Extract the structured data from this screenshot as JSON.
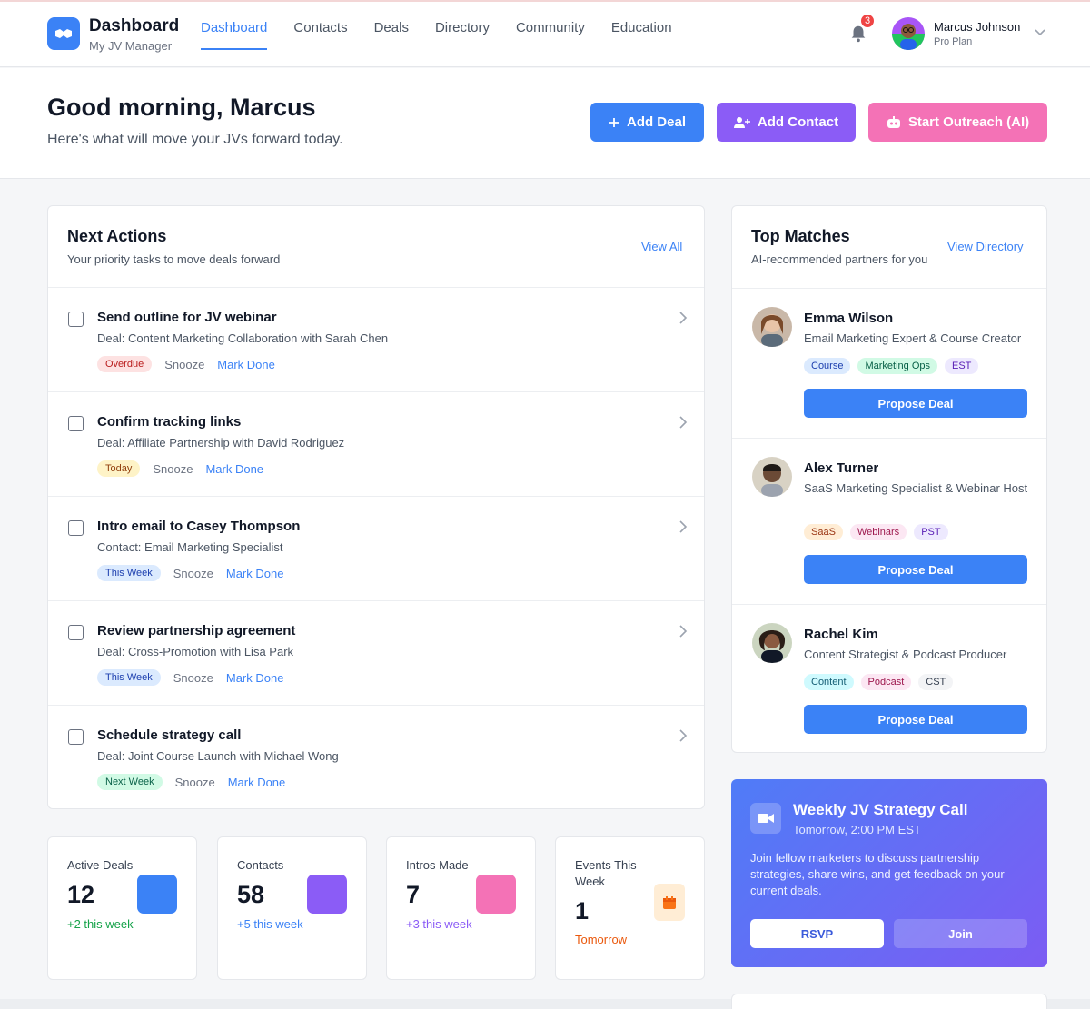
{
  "header": {
    "brand_title": "Dashboard",
    "brand_subtitle": "My JV Manager",
    "nav": [
      "Dashboard",
      "Contacts",
      "Deals",
      "Directory",
      "Community",
      "Education"
    ],
    "active_nav": "Dashboard",
    "notification_count": "3",
    "user_name": "Marcus Johnson",
    "user_plan": "Pro Plan"
  },
  "hero": {
    "greeting": "Good morning, Marcus",
    "subtitle": "Here's what will move your JVs forward today.",
    "add_deal": "Add Deal",
    "add_contact": "Add Contact",
    "start_outreach": "Start Outreach (AI)"
  },
  "next_actions": {
    "title": "Next Actions",
    "subtitle": "Your priority tasks to move deals forward",
    "view_all": "View All",
    "snooze_label": "Snooze",
    "mark_done_label": "Mark Done",
    "items": [
      {
        "title": "Send outline for JV webinar",
        "desc": "Deal: Content Marketing Collaboration with Sarah Chen",
        "tag": "Overdue"
      },
      {
        "title": "Confirm tracking links",
        "desc": "Deal: Affiliate Partnership with David Rodriguez",
        "tag": "Today"
      },
      {
        "title": "Intro email to Casey Thompson",
        "desc": "Contact: Email Marketing Specialist",
        "tag": "This Week"
      },
      {
        "title": "Review partnership agreement",
        "desc": "Deal: Cross-Promotion with Lisa Park",
        "tag": "This Week"
      },
      {
        "title": "Schedule strategy call",
        "desc": "Deal: Joint Course Launch with Michael Wong",
        "tag": "Next Week"
      }
    ]
  },
  "top_matches": {
    "title": "Top Matches",
    "subtitle": "AI-recommended partners for you",
    "view_directory": "View Directory",
    "propose_label": "Propose Deal",
    "items": [
      {
        "name": "Emma Wilson",
        "role": "Email Marketing Expert & Course Creator",
        "tags": [
          "Course",
          "Marketing Ops",
          "EST"
        ]
      },
      {
        "name": "Alex Turner",
        "role": "SaaS Marketing Specialist & Webinar Host",
        "tags": [
          "SaaS",
          "Webinars",
          "PST"
        ]
      },
      {
        "name": "Rachel Kim",
        "role": "Content Strategist & Podcast Producer",
        "tags": [
          "Content",
          "Podcast",
          "CST"
        ]
      }
    ]
  },
  "stats": [
    {
      "label": "Active Deals",
      "value": "12",
      "delta": "+2 this week",
      "color": "#3b82f6"
    },
    {
      "label": "Contacts",
      "value": "58",
      "delta": "+5 this week",
      "color": "#8b5cf6"
    },
    {
      "label": "Intros Made",
      "value": "7",
      "delta": "+3 this week",
      "color": "#f472b6"
    },
    {
      "label": "Events This Week",
      "value": "1",
      "delta": "Tomorrow",
      "color": "#f97316"
    }
  ],
  "strategy_call": {
    "title": "Weekly JV Strategy Call",
    "time": "Tomorrow, 2:00 PM EST",
    "desc": "Join fellow marketers to discuss partnership strategies, share wins, and get feedback on your current deals.",
    "rsvp": "RSVP",
    "join": "Join"
  }
}
